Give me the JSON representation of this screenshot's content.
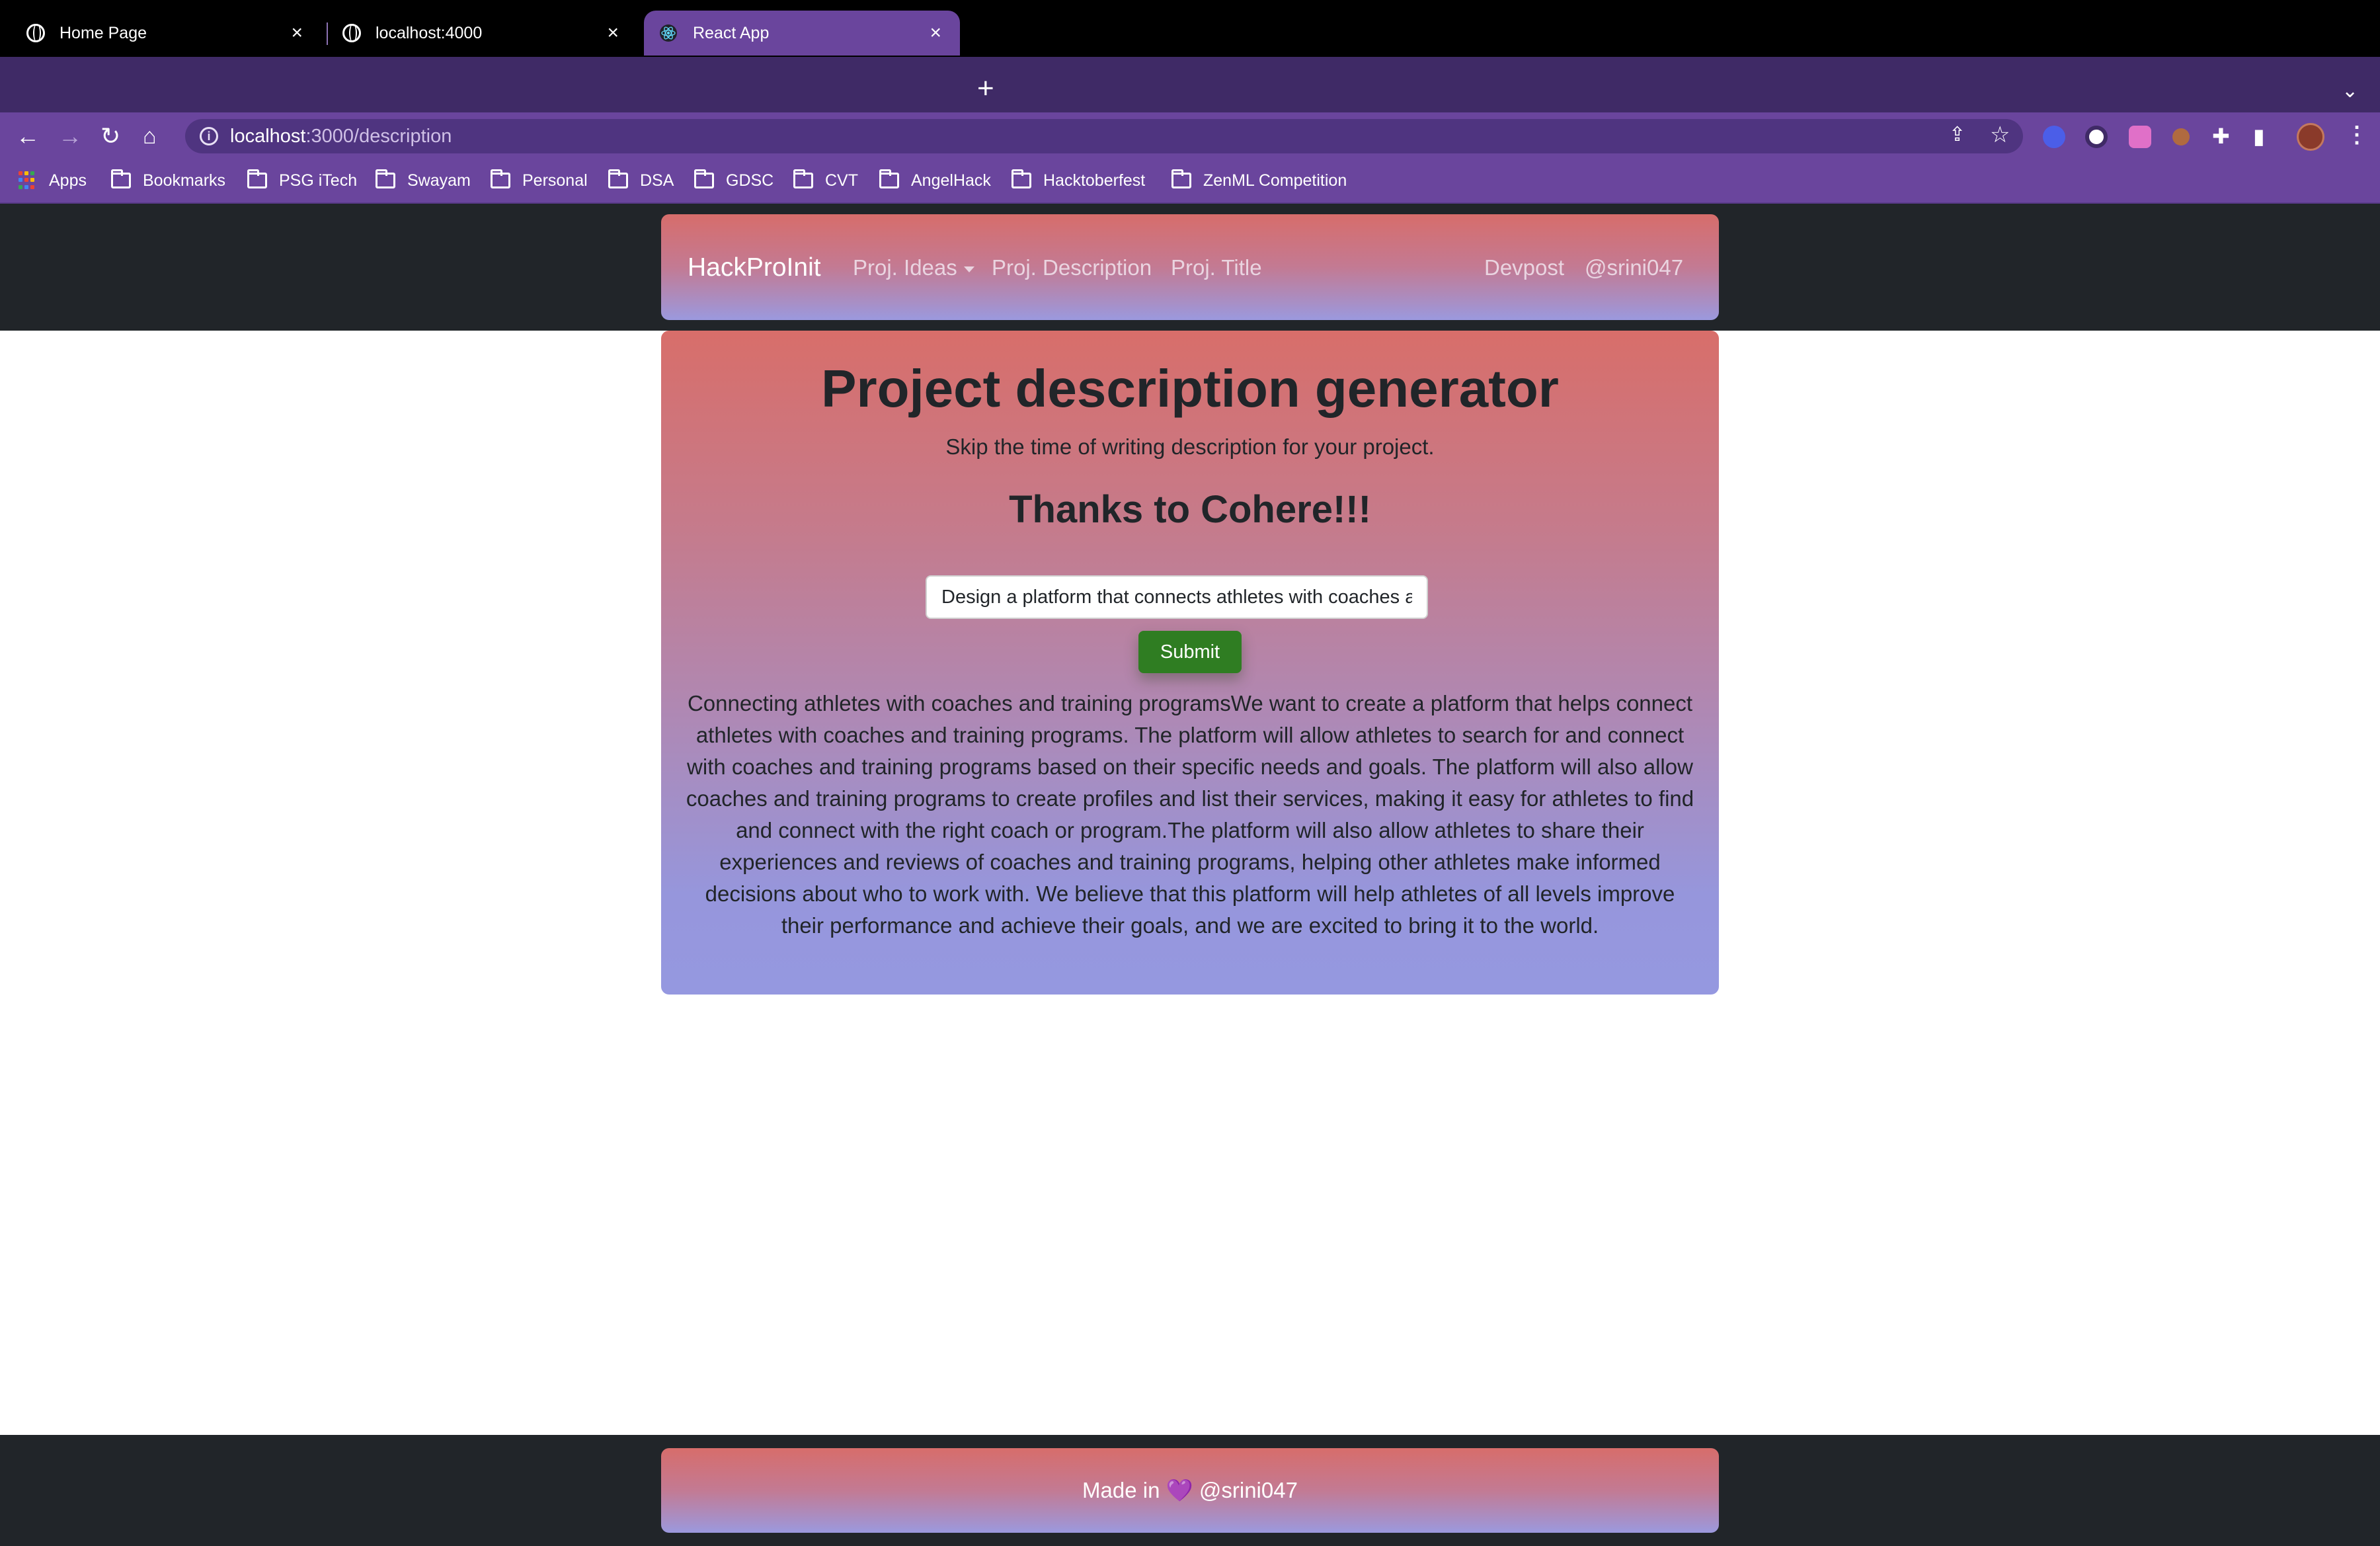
{
  "browser": {
    "tabs": [
      {
        "title": "Home Page",
        "active": false,
        "icon": "globe-icon"
      },
      {
        "title": "localhost:4000",
        "active": false,
        "icon": "globe-icon"
      },
      {
        "title": "React App",
        "active": true,
        "icon": "react-icon"
      }
    ],
    "new_tab_icon": "plus-icon",
    "url_host": "localhost",
    "url_path": ":3000/description",
    "bookmarks": [
      {
        "label": "Apps",
        "icon": "apps-grid-icon"
      },
      {
        "label": "Bookmarks",
        "icon": "folder-icon"
      },
      {
        "label": "PSG iTech",
        "icon": "folder-icon"
      },
      {
        "label": "Swayam",
        "icon": "folder-icon"
      },
      {
        "label": "Personal",
        "icon": "folder-icon"
      },
      {
        "label": "DSA",
        "icon": "folder-icon"
      },
      {
        "label": "GDSC",
        "icon": "folder-icon"
      },
      {
        "label": "CVT",
        "icon": "folder-icon"
      },
      {
        "label": "AngelHack",
        "icon": "folder-icon"
      },
      {
        "label": "Hacktoberfest",
        "icon": "folder-icon"
      },
      {
        "label": "ZenML Competition",
        "icon": "folder-icon"
      }
    ]
  },
  "navbar": {
    "brand": "HackProInit",
    "links": [
      {
        "label": "Proj. Ideas",
        "dropdown": true
      },
      {
        "label": "Proj. Description"
      },
      {
        "label": "Proj. Title"
      }
    ],
    "right_links": [
      {
        "label": "Devpost"
      },
      {
        "label": "@srini047"
      }
    ]
  },
  "main": {
    "title": "Project description generator",
    "subtitle": "Skip the time of writing description for your project.",
    "thanks": "Thanks to Cohere!!!",
    "input_value": "Design a platform that connects athletes with coaches and training programs",
    "submit_label": "Submit",
    "description": "Connecting athletes with coaches and training programsWe want to create a platform that helps connect athletes with coaches and training programs. The platform will allow athletes to search for and connect with coaches and training programs based on their specific needs and goals. The platform will also allow coaches and training programs to create profiles and list their services, making it easy for athletes to find and connect with the right coach or program.The platform will also allow athletes to share their experiences and reviews of coaches and training programs, helping other athletes make informed decisions about who to work with. We believe that this platform will help athletes of all levels improve their performance and achieve their goals, and we are excited to bring it to the world."
  },
  "footer": {
    "prefix": "Made in",
    "heart": "💜",
    "handle": "@srini047"
  },
  "colors": {
    "browser_frame": "#6a459d",
    "tabstrip": "#3f2a66",
    "page_dark": "#212529",
    "gradient_top": "#d86e6a",
    "gradient_bottom": "#9598e0",
    "submit_green": "#2f7d22"
  }
}
